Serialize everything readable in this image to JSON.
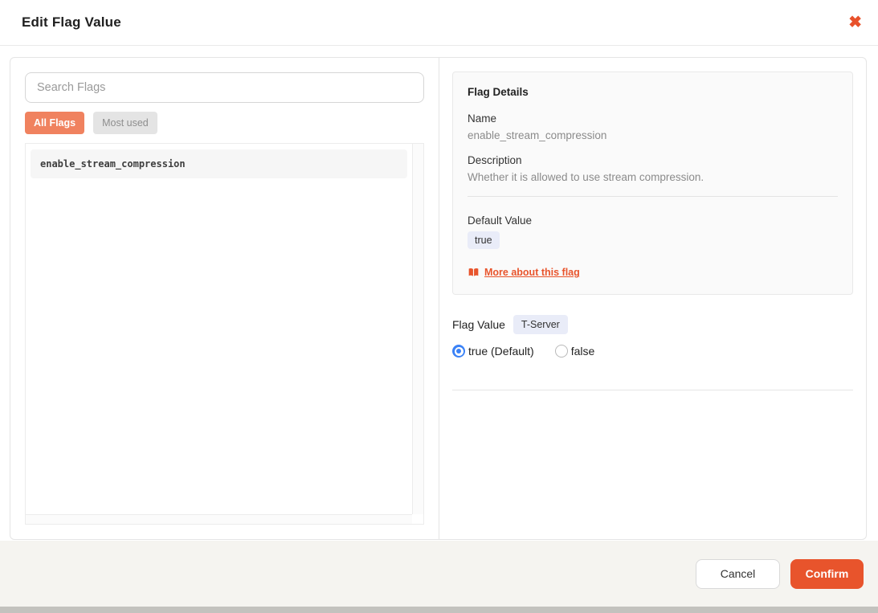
{
  "header": {
    "title": "Edit Flag Value",
    "close_icon": "✖"
  },
  "left_panel": {
    "search": {
      "placeholder": "Search Flags",
      "value": ""
    },
    "filters": [
      {
        "label": "All Flags",
        "active": true
      },
      {
        "label": "Most used",
        "active": false
      }
    ],
    "flags": [
      "enable_stream_compression"
    ]
  },
  "details": {
    "title": "Flag Details",
    "name_label": "Name",
    "name": "enable_stream_compression",
    "description_label": "Description",
    "description": "Whether it is allowed to use stream compression.",
    "default_value_label": "Default Value",
    "default_value": "true",
    "more_link_label": "More about this flag"
  },
  "flag_value": {
    "label": "Flag Value",
    "scope_badge": "T-Server",
    "options": [
      {
        "label": "true (Default)",
        "selected": true
      },
      {
        "label": "false",
        "selected": false
      }
    ]
  },
  "footer": {
    "cancel_label": "Cancel",
    "confirm_label": "Confirm"
  },
  "colors": {
    "accent": "#e8542c",
    "accent_light": "#f0825f",
    "radio_blue": "#3b82f6",
    "badge_bg": "#e9ecf8",
    "footer_bg": "#f5f4f0"
  }
}
